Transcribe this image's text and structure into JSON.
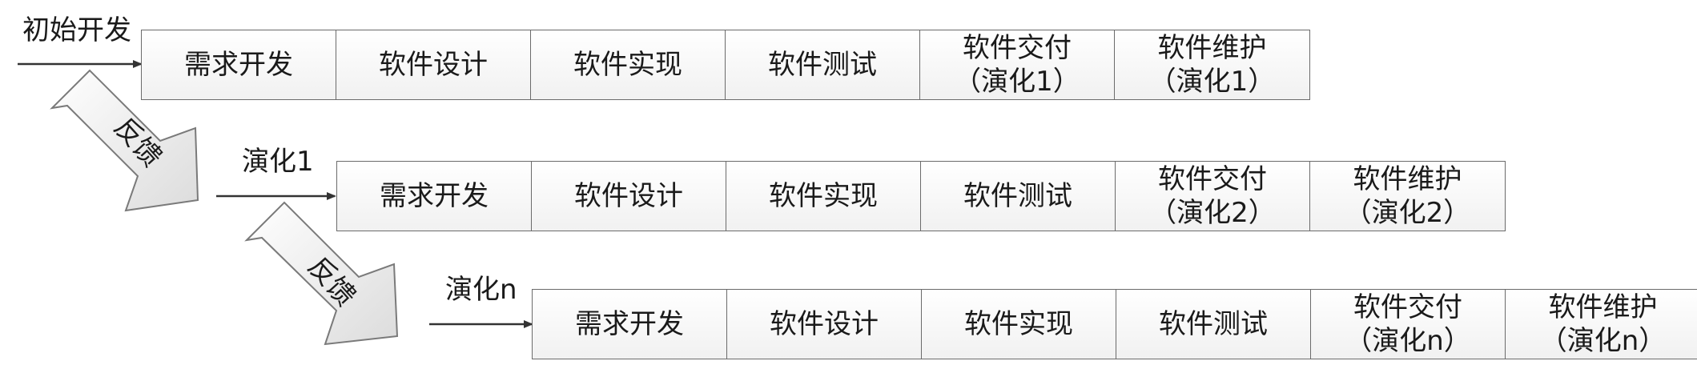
{
  "labels": {
    "start": "初始开发",
    "evo1": "演化1",
    "evon": "演化n",
    "feedback": "反馈"
  },
  "rows": [
    {
      "cells": [
        {
          "line1": "需求开发",
          "line2": ""
        },
        {
          "line1": "软件设计",
          "line2": ""
        },
        {
          "line1": "软件实现",
          "line2": ""
        },
        {
          "line1": "软件测试",
          "line2": ""
        },
        {
          "line1": "软件交付",
          "line2": "（演化1）"
        },
        {
          "line1": "软件维护",
          "line2": "（演化1）"
        }
      ]
    },
    {
      "cells": [
        {
          "line1": "需求开发",
          "line2": ""
        },
        {
          "line1": "软件设计",
          "line2": ""
        },
        {
          "line1": "软件实现",
          "line2": ""
        },
        {
          "line1": "软件测试",
          "line2": ""
        },
        {
          "line1": "软件交付",
          "line2": "（演化2）"
        },
        {
          "line1": "软件维护",
          "line2": "（演化2）"
        }
      ]
    },
    {
      "cells": [
        {
          "line1": "需求开发",
          "line2": ""
        },
        {
          "line1": "软件设计",
          "line2": ""
        },
        {
          "line1": "软件实现",
          "line2": ""
        },
        {
          "line1": "软件测试",
          "line2": ""
        },
        {
          "line1": "软件交付",
          "line2": "（演化n）"
        },
        {
          "line1": "软件维护",
          "line2": "（演化n）"
        }
      ]
    }
  ]
}
